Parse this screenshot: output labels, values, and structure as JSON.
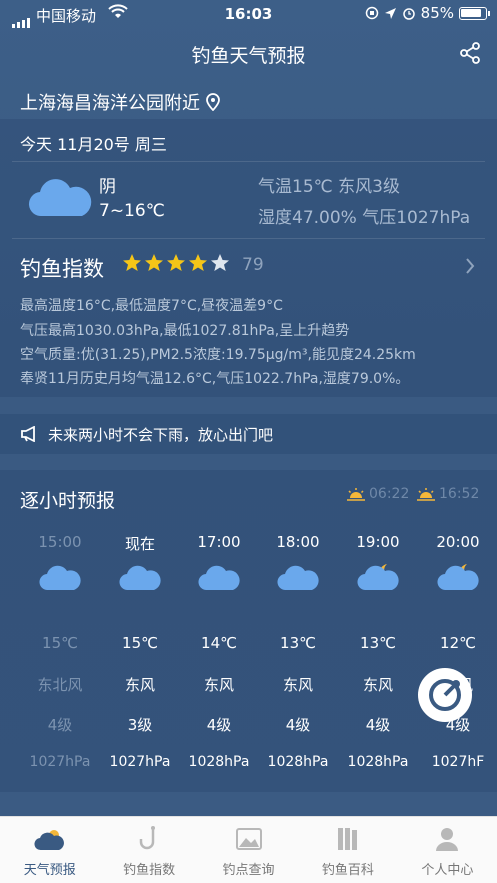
{
  "status_bar": {
    "carrier": "中国移动",
    "time": "16:03",
    "battery": "85%"
  },
  "header": {
    "title": "钓鱼天气预报"
  },
  "location": {
    "name": "上海海昌海洋公园附近"
  },
  "today": {
    "date": "今天 11月20号 周三",
    "condition": "阴",
    "temp_range": "7~16℃",
    "temp_wind": "气温15℃ 东风3级",
    "humidity_pressure": "湿度47.00% 气压1027hPa"
  },
  "fishing_index": {
    "title": "钓鱼指数",
    "score": "79",
    "stars_filled": 4,
    "stars_total": 5,
    "lines": [
      "最高温度16°C,最低温度7°C,昼夜温差9°C",
      "气压最高1030.03hPa,最低1027.81hPa,呈上升趋势",
      "空气质量:优(31.25),PM2.5浓度:19.75μg/m³,能见度24.25km",
      "奉贤11月历史月均气温12.6°C,气压1022.7hPa,湿度79.0%。"
    ]
  },
  "tip": {
    "text": "未来两小时不会下雨，放心出门吧"
  },
  "hourly": {
    "title": "逐小时预报",
    "sunrise": "06:22",
    "sunset": "16:52",
    "items": [
      {
        "hour": "15:00",
        "icon": "cloud-icon",
        "temp": "15℃",
        "wind": "东北风",
        "level": "4级",
        "pressure": "1027hPa",
        "dim": true
      },
      {
        "hour": "现在",
        "icon": "cloud-icon",
        "temp": "15℃",
        "wind": "东风",
        "level": "3级",
        "pressure": "1027hPa",
        "dim": false
      },
      {
        "hour": "17:00",
        "icon": "cloud-icon",
        "temp": "14℃",
        "wind": "东风",
        "level": "4级",
        "pressure": "1028hPa",
        "dim": false
      },
      {
        "hour": "18:00",
        "icon": "cloud-icon",
        "temp": "13℃",
        "wind": "东风",
        "level": "4级",
        "pressure": "1028hPa",
        "dim": false
      },
      {
        "hour": "19:00",
        "icon": "cloud-moon-icon",
        "temp": "13℃",
        "wind": "东风",
        "level": "4级",
        "pressure": "1028hPa",
        "dim": false
      },
      {
        "hour": "20:00",
        "icon": "cloud-moon-icon",
        "temp": "12℃",
        "wind": "东风",
        "level": "4级",
        "pressure": "1027hF",
        "dim": false
      }
    ]
  },
  "tabs": [
    {
      "label": "天气预报",
      "icon": "weather-icon",
      "active": true
    },
    {
      "label": "钓鱼指数",
      "icon": "fishing-hook-icon",
      "active": false
    },
    {
      "label": "钓点查询",
      "icon": "fishing-spot-icon",
      "active": false
    },
    {
      "label": "钓鱼百科",
      "icon": "encyclopedia-icon",
      "active": false
    },
    {
      "label": "个人中心",
      "icon": "user-icon",
      "active": false
    }
  ],
  "colors": {
    "background": "#3a5a82",
    "cloud": "#6aa8ec",
    "star": "#f5c518",
    "moon": "#f4b73a"
  }
}
